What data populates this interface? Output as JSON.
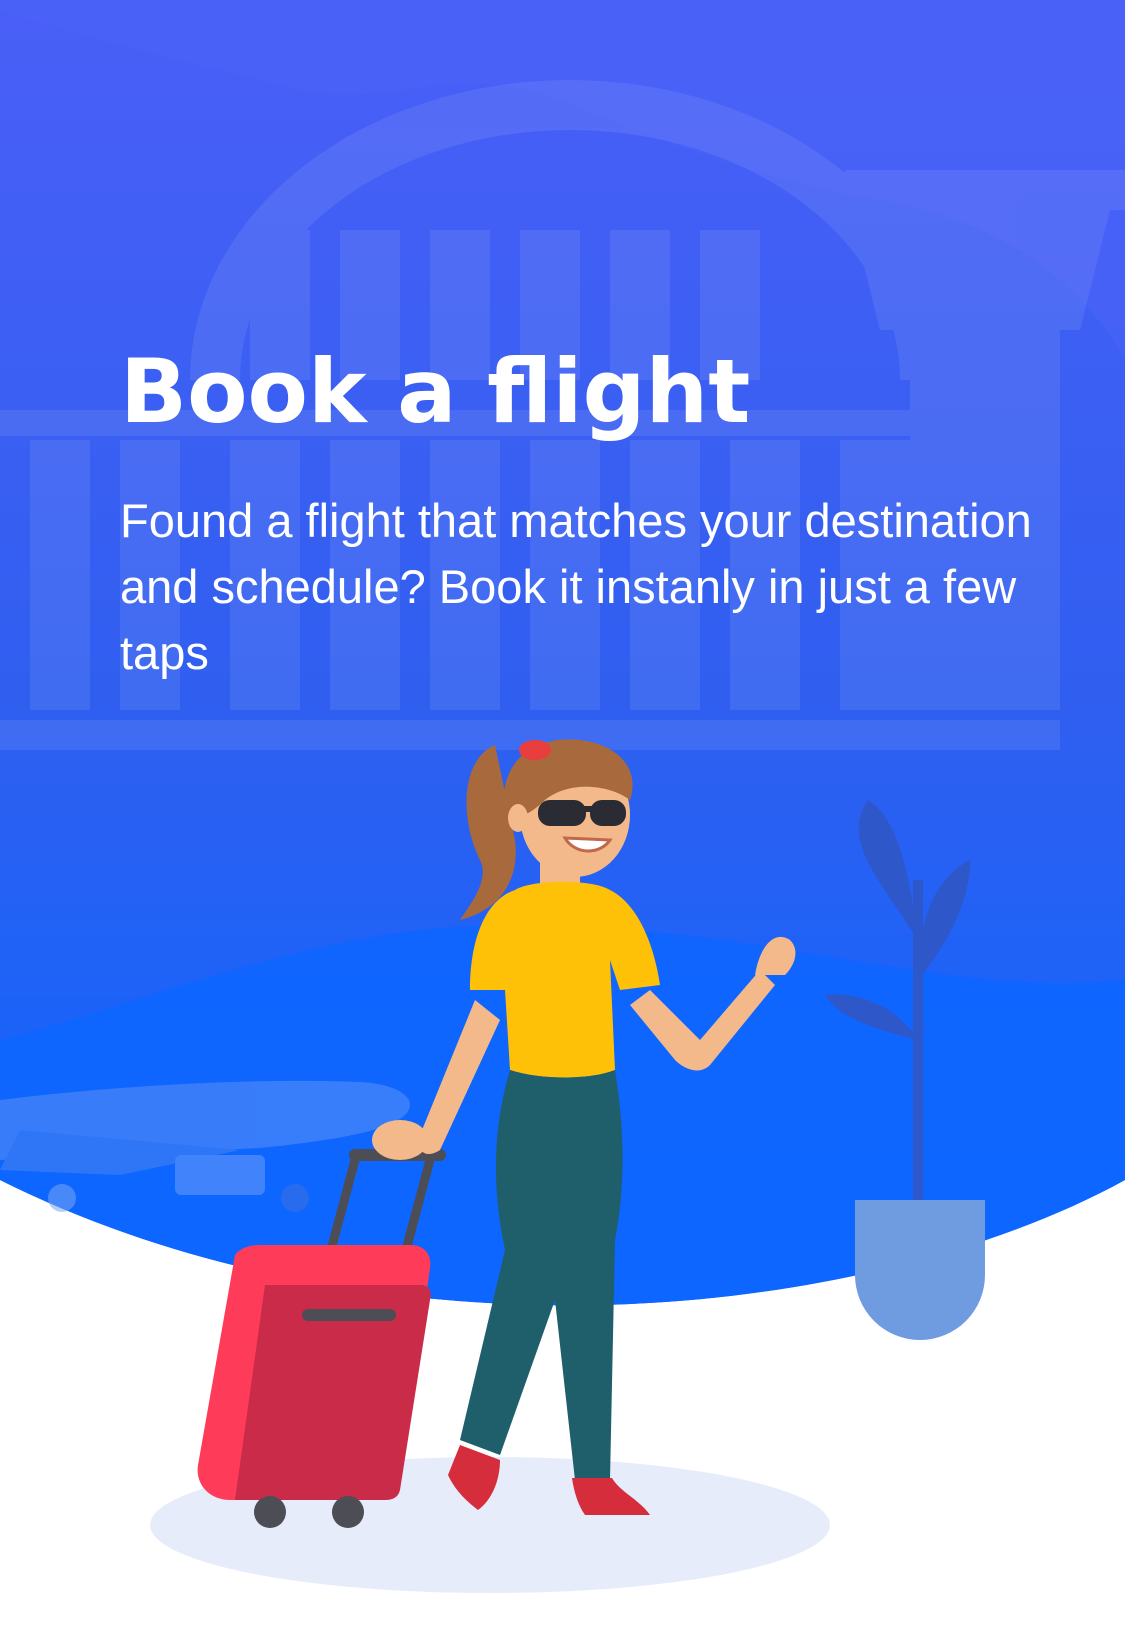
{
  "screen": {
    "title": "Book a flight",
    "description": "Found a flight that matches your destination and schedule? Book it instanly in just a few taps"
  },
  "illustration": {
    "subject": "woman-with-suitcase-waving",
    "colors": {
      "background_top": "#4a5ff7",
      "background_bottom": "#0a66ff",
      "shirt": "#ffc107",
      "pants": "#1f5f6b",
      "hair": "#a86a3c",
      "skin": "#f4b98a",
      "suitcase": "#e8314f",
      "shoes": "#d62d3d",
      "plant_pot": "#6f9ce0",
      "ground_shadow": "#e6ecfa"
    }
  }
}
